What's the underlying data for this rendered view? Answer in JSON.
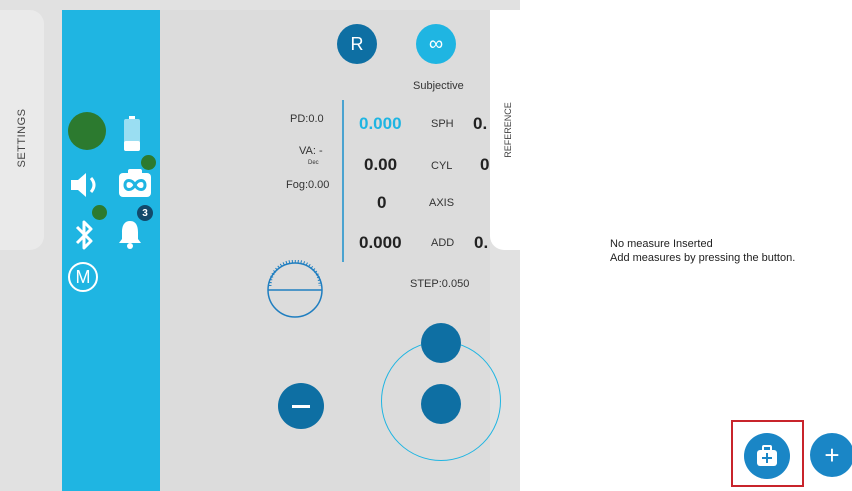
{
  "settings": {
    "label": "SETTINGS"
  },
  "reference": {
    "label": "REFERENCE"
  },
  "header": {
    "r_label": "R",
    "infinity_label": "∞",
    "mode_label": "Subjective"
  },
  "left_info": {
    "pd": "PD:0.0",
    "va": "VA: -",
    "va_sub": "Dec",
    "fog": "Fog:0.00"
  },
  "measurements": [
    {
      "value": "0.000",
      "label": "SPH",
      "extra": "0."
    },
    {
      "value": "0.00",
      "label": "CYL",
      "extra": "0"
    },
    {
      "value": "0",
      "label": "AXIS",
      "extra": ""
    },
    {
      "value": "0.000",
      "label": "ADD",
      "extra": "0."
    }
  ],
  "step": "STEP:0.050",
  "notifications": {
    "count": "3"
  },
  "m_label": "M",
  "empty_state": {
    "line1": "No measure Inserted",
    "line2": "Add measures by pressing the button."
  },
  "colors": {
    "accent_light": "#1fb5e2",
    "accent_dark": "#0e6fa3",
    "status_green": "#2c7a2f",
    "highlight": "#c8242b"
  },
  "icons": [
    "battery-icon",
    "speaker-icon",
    "infinity-camera-icon",
    "bluetooth-icon",
    "bell-icon",
    "m-circle-icon",
    "minus-icon",
    "medical-case-icon",
    "plus-icon"
  ]
}
